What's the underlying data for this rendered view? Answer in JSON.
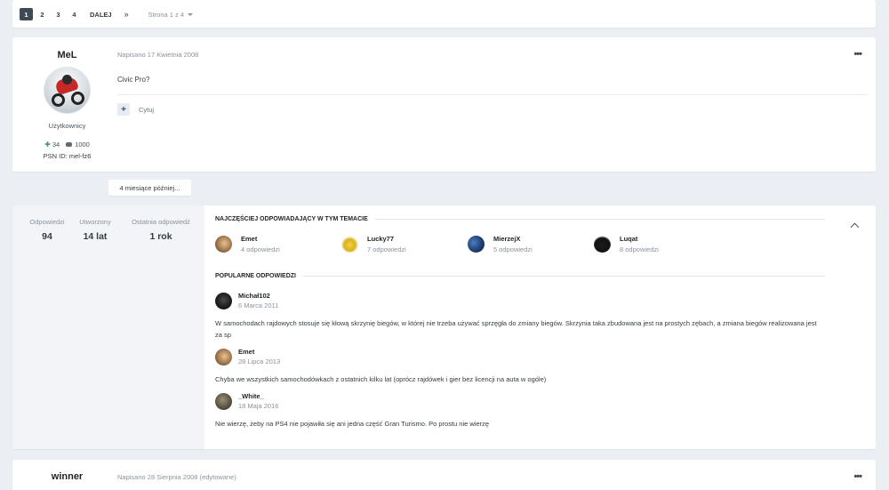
{
  "pagination": {
    "pages": [
      "1",
      "2",
      "3",
      "4"
    ],
    "active_page": "1",
    "next_label": "DALEJ",
    "last_label": "»",
    "page_info": "Strona 1 z 4"
  },
  "post1": {
    "author": "MeL",
    "group": "Użytkownicy",
    "reputation": "34",
    "comments": "1000",
    "psn": "PSN ID: mel-fz6",
    "date": "Napisano 17 Kwietnia 2008",
    "text": "Civic Pro?",
    "quote_label": "Cytuj",
    "plus_label": "+",
    "more_label": "•••"
  },
  "time_gap": "4 miesiące później...",
  "summary": {
    "stats": [
      {
        "label": "Odpowiedzi",
        "value": "94"
      },
      {
        "label": "Utworzony",
        "value": "14 lat"
      },
      {
        "label": "Ostatnia odpowiedź",
        "value": "1 rok"
      }
    ],
    "top_posters_title": "NAJCZĘŚCIEJ ODPOWIADAJĄCY W TYM TEMACIE",
    "top_posters": [
      {
        "name": "Emet",
        "count": "4 odpowiedzi"
      },
      {
        "name": "Lucky77",
        "count": "7 odpowiedzi"
      },
      {
        "name": "MierzejX",
        "count": "5 odpowiedzi"
      },
      {
        "name": "Luqat",
        "count": "8 odpowiedzi"
      }
    ],
    "popular_title": "POPULARNE ODPOWIEDZI",
    "popular_replies": [
      {
        "author": "Michał102",
        "date": "6 Marca 2011",
        "text": "W samochodach rajdowych stosuje się kłową skrzynię biegów, w której nie trzeba używać sprzęgła do zmiany biegów. Skrzynia taka zbudowana jest na prostych zębach, a zmiana biegów realizowana jest za sp"
      },
      {
        "author": "Emet",
        "date": "28 Lipca 2013",
        "text": "Chyba we wszystkich samochodówkach z ostatnich kilku lat (oprócz rajdówek i gier bez licencji na auta w ogóle)"
      },
      {
        "author": "_White_",
        "date": "18 Maja 2016",
        "text": "Nie wierzę, żeby na PS4 nie pojawiła się ani jedna część Gran Turismo. Po prostu nie wierzę"
      }
    ]
  },
  "post2": {
    "author": "winner",
    "date": "Napisano 28 Sierpnia 2008 (edytowane)",
    "more_label": "•••"
  }
}
